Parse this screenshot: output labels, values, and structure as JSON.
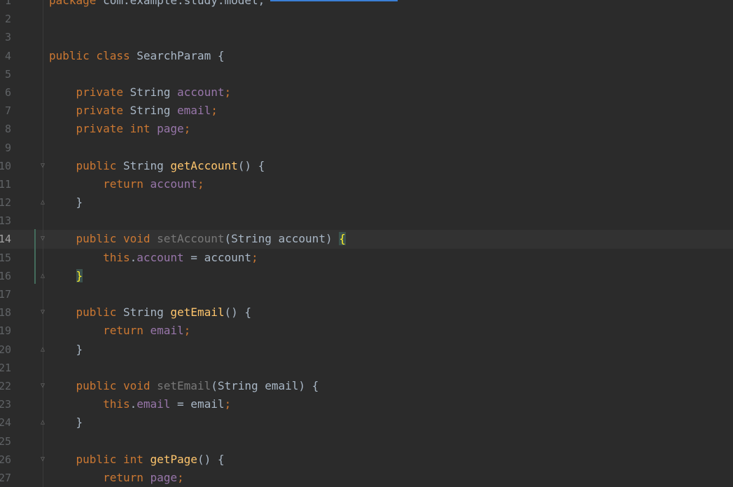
{
  "editor": {
    "lines": [
      {
        "n": "1",
        "tokens": [
          {
            "c": "k",
            "s": "package "
          },
          {
            "c": "t",
            "s": "com.example.study.model;"
          }
        ]
      },
      {
        "n": "2",
        "tokens": []
      },
      {
        "n": "3",
        "tokens": []
      },
      {
        "n": "4",
        "tokens": [
          {
            "c": "k",
            "s": "public class "
          },
          {
            "c": "t",
            "s": "SearchParam {"
          }
        ]
      },
      {
        "n": "5",
        "tokens": []
      },
      {
        "n": "6",
        "tokens": [
          {
            "c": "k",
            "s": "    private "
          },
          {
            "c": "t",
            "s": "String "
          },
          {
            "c": "f",
            "s": "account"
          },
          {
            "c": "k",
            "s": ";"
          }
        ]
      },
      {
        "n": "7",
        "tokens": [
          {
            "c": "k",
            "s": "    private "
          },
          {
            "c": "t",
            "s": "String "
          },
          {
            "c": "f",
            "s": "email"
          },
          {
            "c": "k",
            "s": ";"
          }
        ]
      },
      {
        "n": "8",
        "tokens": [
          {
            "c": "k",
            "s": "    private int "
          },
          {
            "c": "f",
            "s": "page"
          },
          {
            "c": "k",
            "s": ";"
          }
        ]
      },
      {
        "n": "9",
        "tokens": []
      },
      {
        "n": "10",
        "fold": "open",
        "tokens": [
          {
            "c": "k",
            "s": "    public "
          },
          {
            "c": "t",
            "s": "String "
          },
          {
            "c": "m",
            "s": "getAccount"
          },
          {
            "c": "t",
            "s": "() {"
          }
        ]
      },
      {
        "n": "11",
        "tokens": [
          {
            "c": "k",
            "s": "        return "
          },
          {
            "c": "f",
            "s": "account"
          },
          {
            "c": "k",
            "s": ";"
          }
        ]
      },
      {
        "n": "12",
        "fold": "close",
        "tokens": [
          {
            "c": "t",
            "s": "    }"
          }
        ]
      },
      {
        "n": "13",
        "tokens": []
      },
      {
        "n": "14",
        "current": true,
        "fold": "open",
        "tokens": [
          {
            "c": "k",
            "s": "    public void "
          },
          {
            "c": "g",
            "s": "setAccount"
          },
          {
            "c": "t",
            "s": "(String account) "
          },
          {
            "c": "brace-hl",
            "s": "{"
          }
        ]
      },
      {
        "n": "15",
        "tokens": [
          {
            "c": "k",
            "s": "        this"
          },
          {
            "c": "t",
            "s": "."
          },
          {
            "c": "f",
            "s": "account"
          },
          {
            "c": "t",
            "s": " = account"
          },
          {
            "c": "k",
            "s": ";"
          }
        ]
      },
      {
        "n": "16",
        "fold": "close",
        "tokens": [
          {
            "c": "t",
            "s": "    "
          },
          {
            "c": "brace-hl",
            "s": "}"
          }
        ]
      },
      {
        "n": "17",
        "tokens": []
      },
      {
        "n": "18",
        "fold": "open",
        "tokens": [
          {
            "c": "k",
            "s": "    public "
          },
          {
            "c": "t",
            "s": "String "
          },
          {
            "c": "m",
            "s": "getEmail"
          },
          {
            "c": "t",
            "s": "() {"
          }
        ]
      },
      {
        "n": "19",
        "tokens": [
          {
            "c": "k",
            "s": "        return "
          },
          {
            "c": "f",
            "s": "email"
          },
          {
            "c": "k",
            "s": ";"
          }
        ]
      },
      {
        "n": "20",
        "fold": "close",
        "tokens": [
          {
            "c": "t",
            "s": "    }"
          }
        ]
      },
      {
        "n": "21",
        "tokens": []
      },
      {
        "n": "22",
        "fold": "open",
        "tokens": [
          {
            "c": "k",
            "s": "    public void "
          },
          {
            "c": "g",
            "s": "setEmail"
          },
          {
            "c": "t",
            "s": "(String email) {"
          }
        ]
      },
      {
        "n": "23",
        "tokens": [
          {
            "c": "k",
            "s": "        this"
          },
          {
            "c": "t",
            "s": "."
          },
          {
            "c": "f",
            "s": "email"
          },
          {
            "c": "t",
            "s": " = email"
          },
          {
            "c": "k",
            "s": ";"
          }
        ]
      },
      {
        "n": "24",
        "fold": "close",
        "tokens": [
          {
            "c": "t",
            "s": "    }"
          }
        ]
      },
      {
        "n": "25",
        "tokens": []
      },
      {
        "n": "26",
        "fold": "open",
        "tokens": [
          {
            "c": "k",
            "s": "    public int "
          },
          {
            "c": "m",
            "s": "getPage"
          },
          {
            "c": "t",
            "s": "() {"
          }
        ]
      },
      {
        "n": "27",
        "tokens": [
          {
            "c": "k",
            "s": "        return "
          },
          {
            "c": "f",
            "s": "page"
          },
          {
            "c": "k",
            "s": ";"
          }
        ]
      }
    ]
  },
  "colors": {
    "background": "#2b2b2b",
    "keyword": "#cc7832",
    "field": "#9876aa",
    "method": "#ffc66d",
    "text": "#a9b7c6",
    "unused": "#787878",
    "brace_match": "#ffef28"
  },
  "icons": {
    "fold_open": "fold-open-icon",
    "fold_close": "fold-close-icon"
  }
}
